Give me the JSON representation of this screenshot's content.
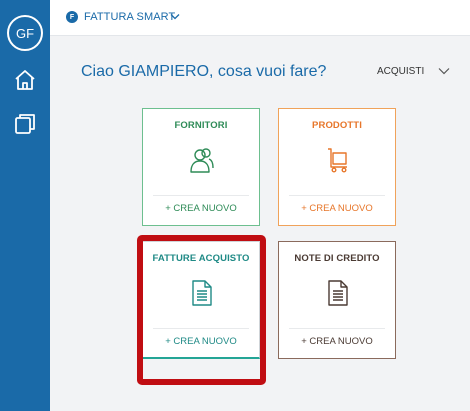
{
  "sidebar": {
    "avatar_initials": "GF",
    "items": [
      {
        "icon": "home-icon"
      },
      {
        "icon": "documents-icon"
      }
    ]
  },
  "topbar": {
    "brand_letter": "F",
    "app_name": "FATTURA SMART"
  },
  "main": {
    "greeting": "Ciao GIAMPIERO, cosa vuoi fare?",
    "section": "ACQUISTI",
    "cards": [
      {
        "title": "FORNITORI",
        "action": "+ CREA NUOVO",
        "icon": "users-icon",
        "color": "#2e8b57"
      },
      {
        "title": "PRODOTTI",
        "action": "+ CREA NUOVO",
        "icon": "cart-icon",
        "color": "#e7762a"
      },
      {
        "title": "FATTURE ACQUISTO",
        "action": "+ CREA NUOVO",
        "icon": "document-icon",
        "color": "#1f8a86"
      },
      {
        "title": "NOTE DI CREDITO",
        "action": "+ CREA NUOVO",
        "icon": "document-icon",
        "color": "#4a3a33"
      }
    ]
  },
  "colors": {
    "sidebar": "#1a6aa8",
    "highlight": "#c00d12",
    "background": "#f2f3f5"
  }
}
